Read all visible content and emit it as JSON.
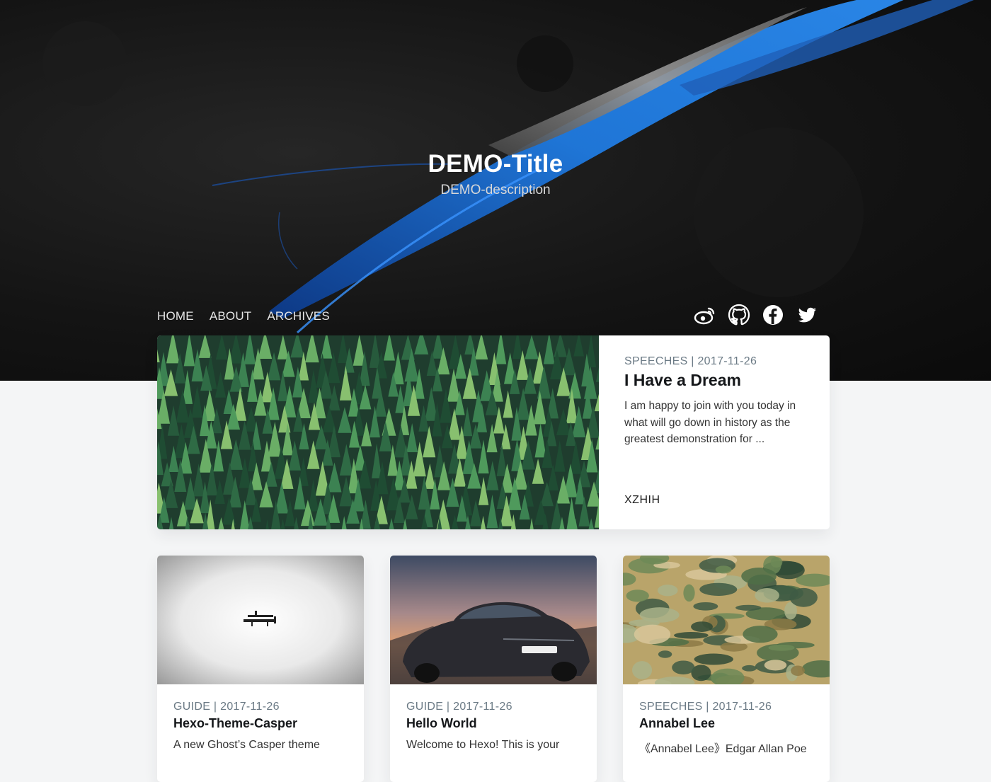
{
  "site": {
    "title": "DEMO-Title",
    "description": "DEMO-description"
  },
  "nav": {
    "items": [
      {
        "label": "HOME"
      },
      {
        "label": "ABOUT"
      },
      {
        "label": "ARCHIVES"
      }
    ]
  },
  "social": [
    "weibo-icon",
    "github-icon",
    "facebook-icon",
    "twitter-icon"
  ],
  "featured": {
    "category": "SPEECHES",
    "date": "2017-11-26",
    "meta": "SPEECHES | 2017-11-26",
    "title": "I Have a Dream",
    "excerpt": "I am happy to join with you today in what will go down in history as the greatest demonstration for ...",
    "author": "XZHIH"
  },
  "cards": [
    {
      "meta": "GUIDE | 2017-11-26",
      "title": "Hexo-Theme-Casper",
      "excerpt": "A new Ghost’s Casper theme"
    },
    {
      "meta": "GUIDE | 2017-11-26",
      "title": "Hello World",
      "excerpt": "Welcome to Hexo! This is your"
    },
    {
      "meta": "SPEECHES | 2017-11-26",
      "title": "Annabel Lee",
      "excerpt": "《Annabel Lee》Edgar Allan Poe"
    }
  ],
  "colors": {
    "accent_blue": "#1e6fd0",
    "page_background": "#f4f5f6",
    "meta_text": "#6b7a85"
  }
}
